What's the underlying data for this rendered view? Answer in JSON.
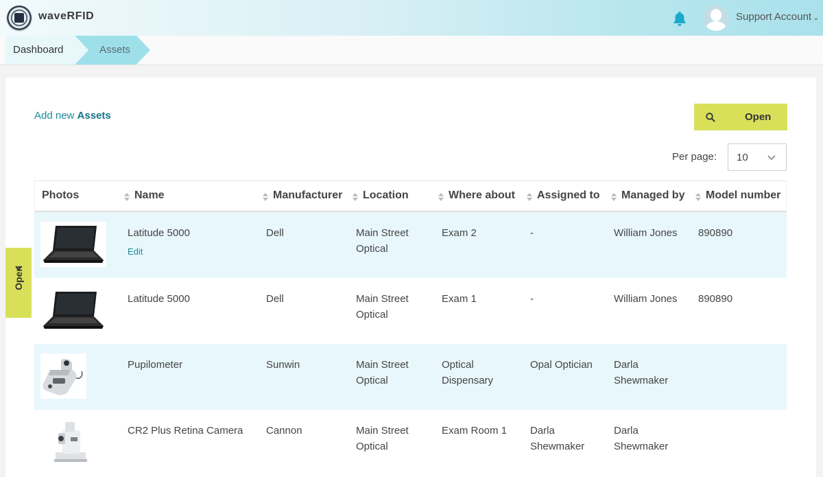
{
  "app": {
    "name": "waveRFID"
  },
  "header": {
    "account_label": "Support Account"
  },
  "breadcrumb": {
    "items": [
      "Dashboard",
      "Assets"
    ]
  },
  "toolbar": {
    "add_prefix": "Add new",
    "add_target": "Assets",
    "open_label": "Open",
    "per_page_label": "Per page:",
    "per_page_value": "10"
  },
  "side_tab": {
    "label": "Open"
  },
  "table": {
    "columns": [
      "Photos",
      "Name",
      "Manufacturer",
      "Location",
      "Where about",
      "Assigned to",
      "Managed by",
      "Model number"
    ],
    "rows": [
      {
        "photo": "laptop",
        "name": "Latitude 5000",
        "edit": "Edit",
        "manufacturer": "Dell",
        "location": "Main Street Optical",
        "where_about": "Exam 2",
        "assigned_to": "-",
        "managed_by": "William Jones",
        "model_number": "890890"
      },
      {
        "photo": "laptop",
        "name": "Latitude 5000",
        "edit": "",
        "manufacturer": "Dell",
        "location": "Main Street Optical",
        "where_about": "Exam 1",
        "assigned_to": "-",
        "managed_by": "William Jones",
        "model_number": "890890"
      },
      {
        "photo": "pupilometer",
        "name": "Pupilometer",
        "edit": "",
        "manufacturer": "Sunwin",
        "location": "Main Street Optical",
        "where_about": "Optical Dispensary",
        "assigned_to": "Opal Optician",
        "managed_by": "Darla Shewmaker",
        "model_number": ""
      },
      {
        "photo": "retina-camera",
        "name": "CR2 Plus Retina Camera",
        "edit": "",
        "manufacturer": "Cannon",
        "location": "Main Street Optical",
        "where_about": "Exam Room 1",
        "assigned_to": "Darla Shewmaker",
        "managed_by": "Darla Shewmaker",
        "model_number": ""
      }
    ]
  },
  "colors": {
    "accent_yellow": "#d8e05a",
    "accent_teal": "#1a8a9a",
    "row_alt": "#e8f7fc"
  }
}
